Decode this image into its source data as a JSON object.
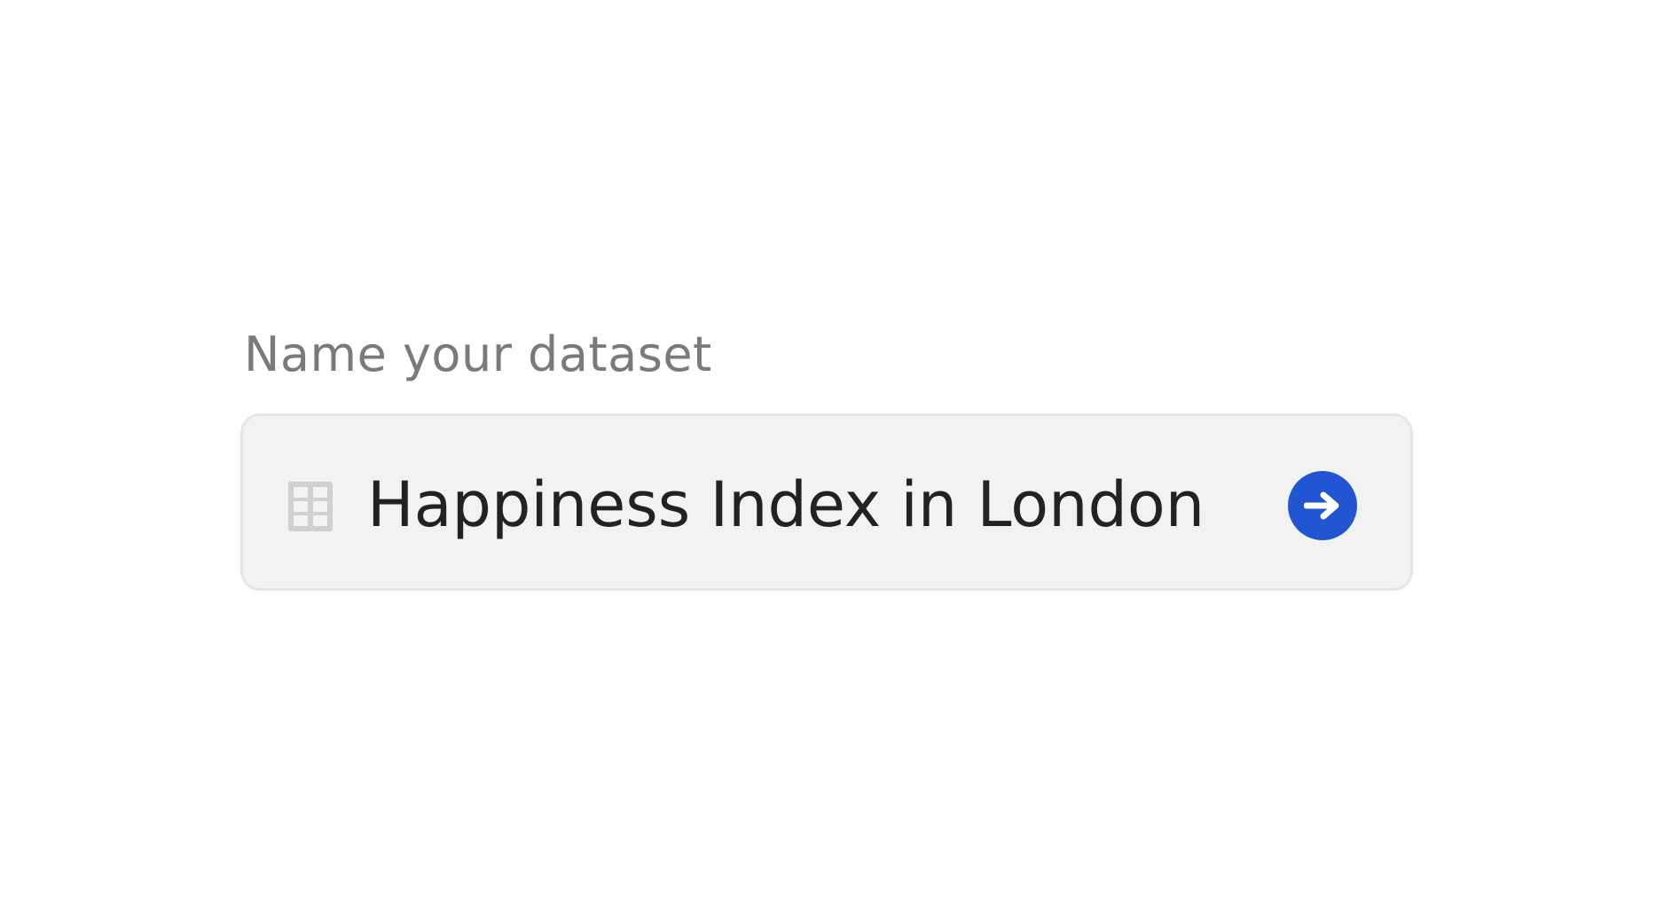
{
  "form": {
    "label": "Name your dataset",
    "input_value": "Happiness Index in London",
    "leading_icon": "table-grid-icon",
    "submit_icon": "arrow-right-icon"
  },
  "colors": {
    "accent": "#2155d1",
    "label": "#7a7a7a",
    "input_text": "#222222",
    "field_background": "#f2f2f2",
    "field_border": "#e6e6e6",
    "icon_gray": "#d0d0d0"
  }
}
